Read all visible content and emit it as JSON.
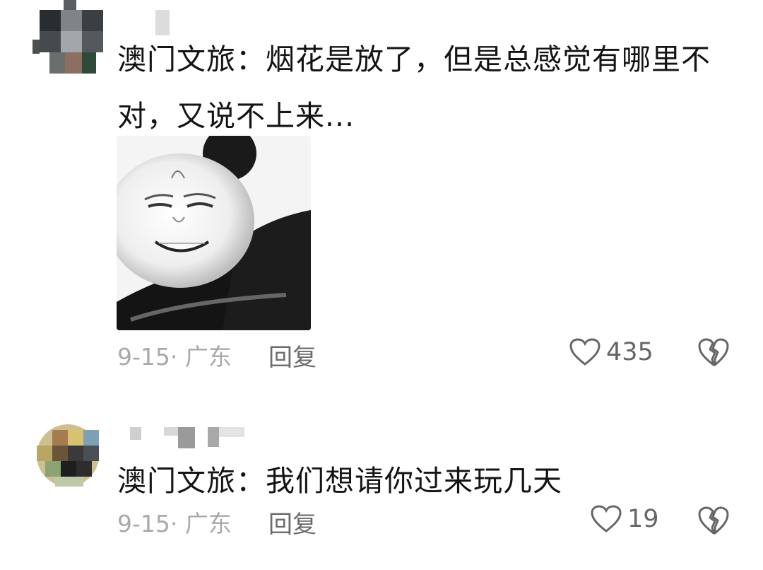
{
  "comments": [
    {
      "text": "澳门文旅：烟花是放了，但是总感觉有哪里不对，又说不上来...",
      "date_location": "9-15· 广东",
      "reply_label": "回复",
      "like_count": "435",
      "has_image": true,
      "avatar": "blurred-avatar"
    },
    {
      "text": "澳门文旅：我们想请你过来玩几天",
      "date_location": "9-15· 广东",
      "reply_label": "回复",
      "like_count": "19",
      "has_image": false,
      "avatar": "blurred-avatar"
    }
  ],
  "icons": {
    "like": "heart-outline-icon",
    "dislike": "broken-heart-icon"
  },
  "colors": {
    "text": "#141414",
    "meta": "#a9a9a9",
    "reply": "#6b6b6b",
    "icon": "#666666"
  }
}
